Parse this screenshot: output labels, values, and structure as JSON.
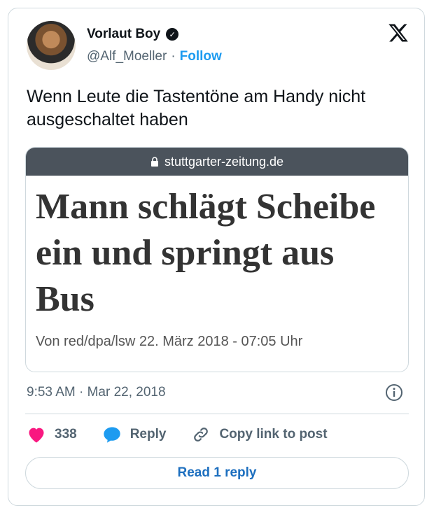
{
  "author": {
    "name": "Vorlaut Boy",
    "handle": "@Alf_Moeller",
    "follow_label": "Follow",
    "separator": "·"
  },
  "tweet": {
    "text": "Wenn Leute die Tastentöne am Handy nicht ausgeschaltet haben",
    "timestamp": "9:53 AM · Mar 22, 2018"
  },
  "embed": {
    "domain": "stuttgarter-zeitung.de",
    "headline": "Mann schlägt Scheibe ein und springt aus Bus",
    "byline": "Von red/dpa/lsw 22. März 2018 - 07:05 Uhr"
  },
  "actions": {
    "like_count": "338",
    "reply_label": "Reply",
    "copy_label": "Copy link to post",
    "read_replies_label": "Read 1 reply"
  },
  "icons": {
    "verified": "verified-badge-icon",
    "logo": "x-logo-icon",
    "info": "info-icon",
    "heart": "heart-icon",
    "reply": "reply-bubble-icon",
    "link": "link-icon",
    "lock": "lock-icon"
  },
  "colors": {
    "accent": "#1d9bf0",
    "heart": "#f91880",
    "reply_icon": "#1d9bf0",
    "embed_bar": "#4b535c"
  }
}
